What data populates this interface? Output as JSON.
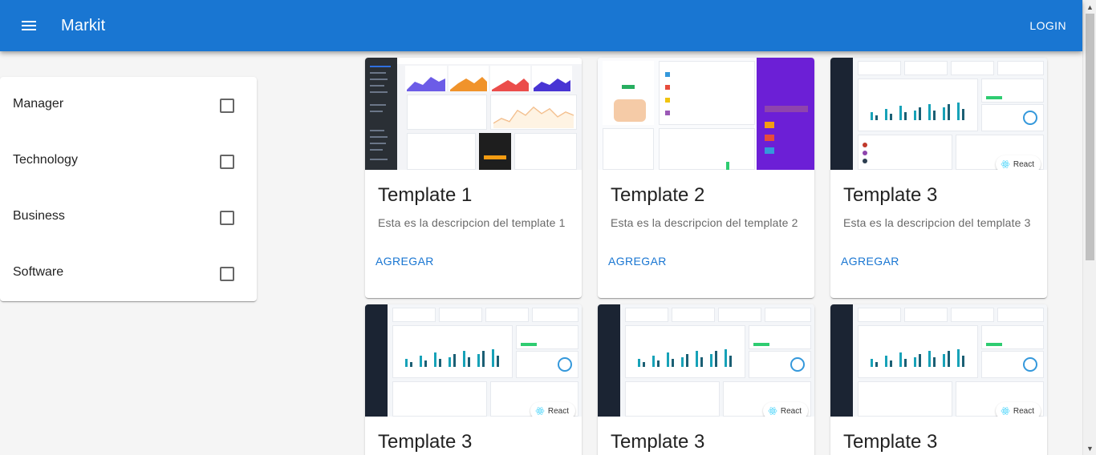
{
  "appbar": {
    "title": "Markit",
    "login_label": "LOGIN"
  },
  "filters": [
    {
      "label": "Manager",
      "checked": false
    },
    {
      "label": "Technology",
      "checked": false
    },
    {
      "label": "Business",
      "checked": false
    },
    {
      "label": "Software",
      "checked": false
    }
  ],
  "cards": [
    {
      "title": "Template 1",
      "description": "Esta es la descripcion del template 1",
      "action": "AGREGAR",
      "thumbnail": "dashboard-dark-charts"
    },
    {
      "title": "Template 2",
      "description": "Esta es la descripcion del template 2",
      "action": "AGREGAR",
      "thumbnail": "dashboard-light-purple"
    },
    {
      "title": "Template 3",
      "description": "Esta es la descripcion del template 3",
      "action": "AGREGAR",
      "thumbnail": "dashboard-react",
      "badge": "React"
    },
    {
      "title": "Template 3",
      "thumbnail": "dashboard-react",
      "badge": "React"
    },
    {
      "title": "Template 3",
      "thumbnail": "dashboard-react",
      "badge": "React"
    },
    {
      "title": "Template 3",
      "thumbnail": "dashboard-react",
      "badge": "React"
    }
  ],
  "colors": {
    "primary": "#1976d2",
    "background": "#f5f5f5"
  }
}
